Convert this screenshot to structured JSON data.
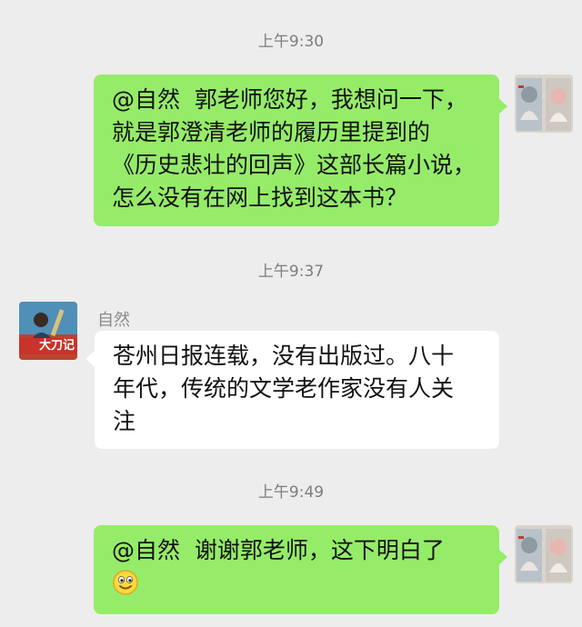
{
  "messages": [
    {
      "time": "上午9:30",
      "sender": "self",
      "lines": [
        "@自然  郭老师您好，我想问一下，",
        "就是郭澄清老师的履历里提到的",
        "《历史悲壮的回声》这部长篇小说，",
        "怎么没有在网上找到这本书？"
      ]
    },
    {
      "time": "上午9:37",
      "sender": "other",
      "name": "自然",
      "avatar_caption": "大刀记",
      "lines": [
        "苍州日报连载，没有出版过。八十",
        "年代，传统的文学老作家没有人关",
        "注"
      ]
    },
    {
      "time": "上午9:49",
      "sender": "self",
      "lines": [
        "@自然  谢谢郭老师，这下明白了"
      ],
      "emoji": "smile-emoji"
    }
  ],
  "colors": {
    "background": "#ededed",
    "self_bubble": "#95ec69",
    "other_bubble": "#ffffff",
    "timestamp": "#7d7d7d"
  }
}
